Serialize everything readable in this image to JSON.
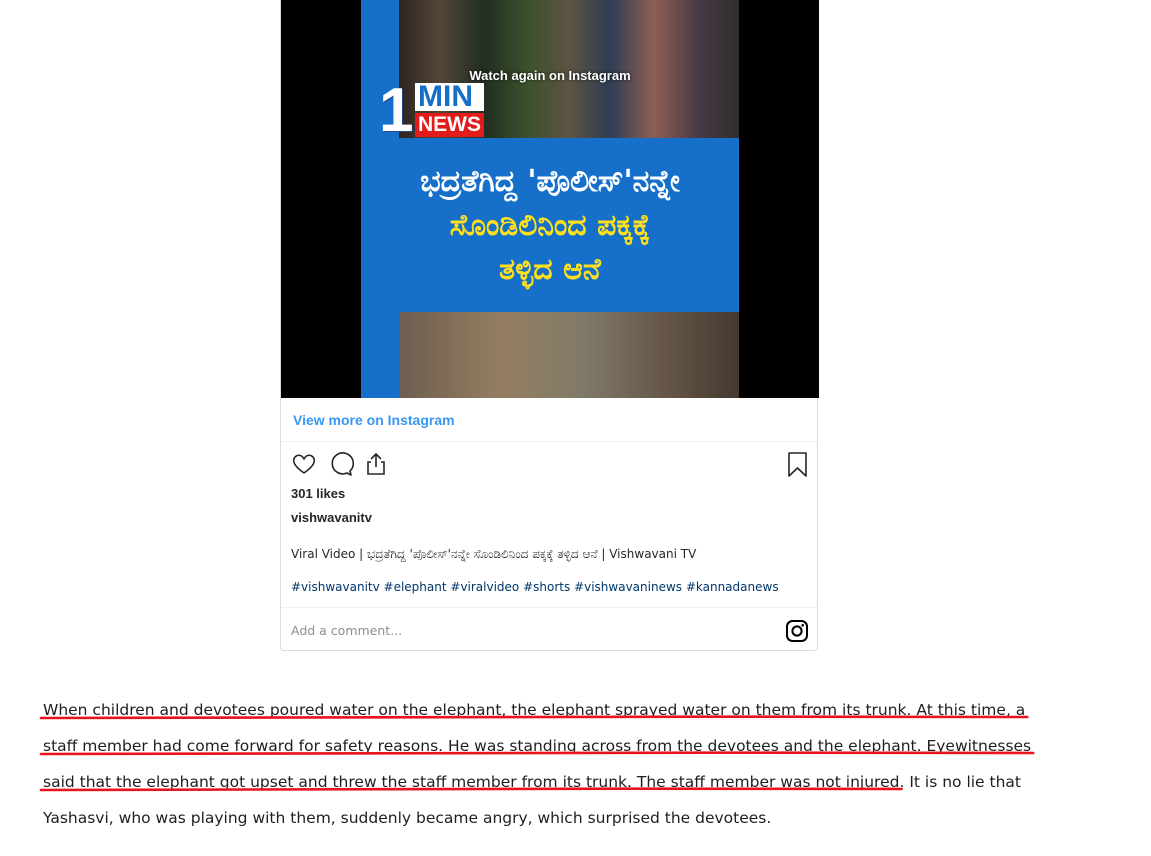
{
  "embed": {
    "watch_again": "Watch again on Instagram",
    "logo": {
      "one": "1",
      "min": "MIN",
      "news": "NEWS"
    },
    "headline": {
      "line1": "ಭದ್ರತೆಗಿದ್ದ 'ಪೊಲೀಸ್'ನನ್ನೇ",
      "line2": "ಸೊಂಡಿಲಿನಿಂದ ಪಕ್ಕಕ್ಕೆ",
      "line3": "ತಳ್ಳಿದ ಆನೆ"
    },
    "view_more": "View more on Instagram",
    "icons": [
      "heart-icon",
      "comment-icon",
      "share-icon",
      "bookmark-icon",
      "instagram-icon"
    ],
    "likes": "301 likes",
    "username": "vishwavanitv",
    "caption": "Viral Video | ಭದ್ರತೆಗಿದ್ದ 'ಪೊಲೀಸ್'ನನ್ನೇ ಸೊಂಡಿಲಿನಿಂದ ಪಕ್ಕಕ್ಕೆ ತಳ್ಳಿದ ಆನೆ | Vishwavani TV",
    "hashtags": "#vishwavanitv #elephant #viralvideo #shorts #vishwavaninews #kannadanews",
    "comment_placeholder": "Add a comment..."
  },
  "article": {
    "line1": "When children and devotees poured water on the elephant, the elephant sprayed water on them from its trunk. At this time, a",
    "line2": "staff member had come forward for safety reasons. He was standing across from the devotees and the elephant. Eyewitnesses",
    "line3_underlined": "said that the elephant got upset and threw the staff member from its trunk. The staff member was not injured",
    "line3_rest": ". It is no lie that",
    "line4": "Yashasvi, who was playing with them, suddenly became angry, which surprised the devotees.",
    "underline_color": "#e8131b"
  }
}
